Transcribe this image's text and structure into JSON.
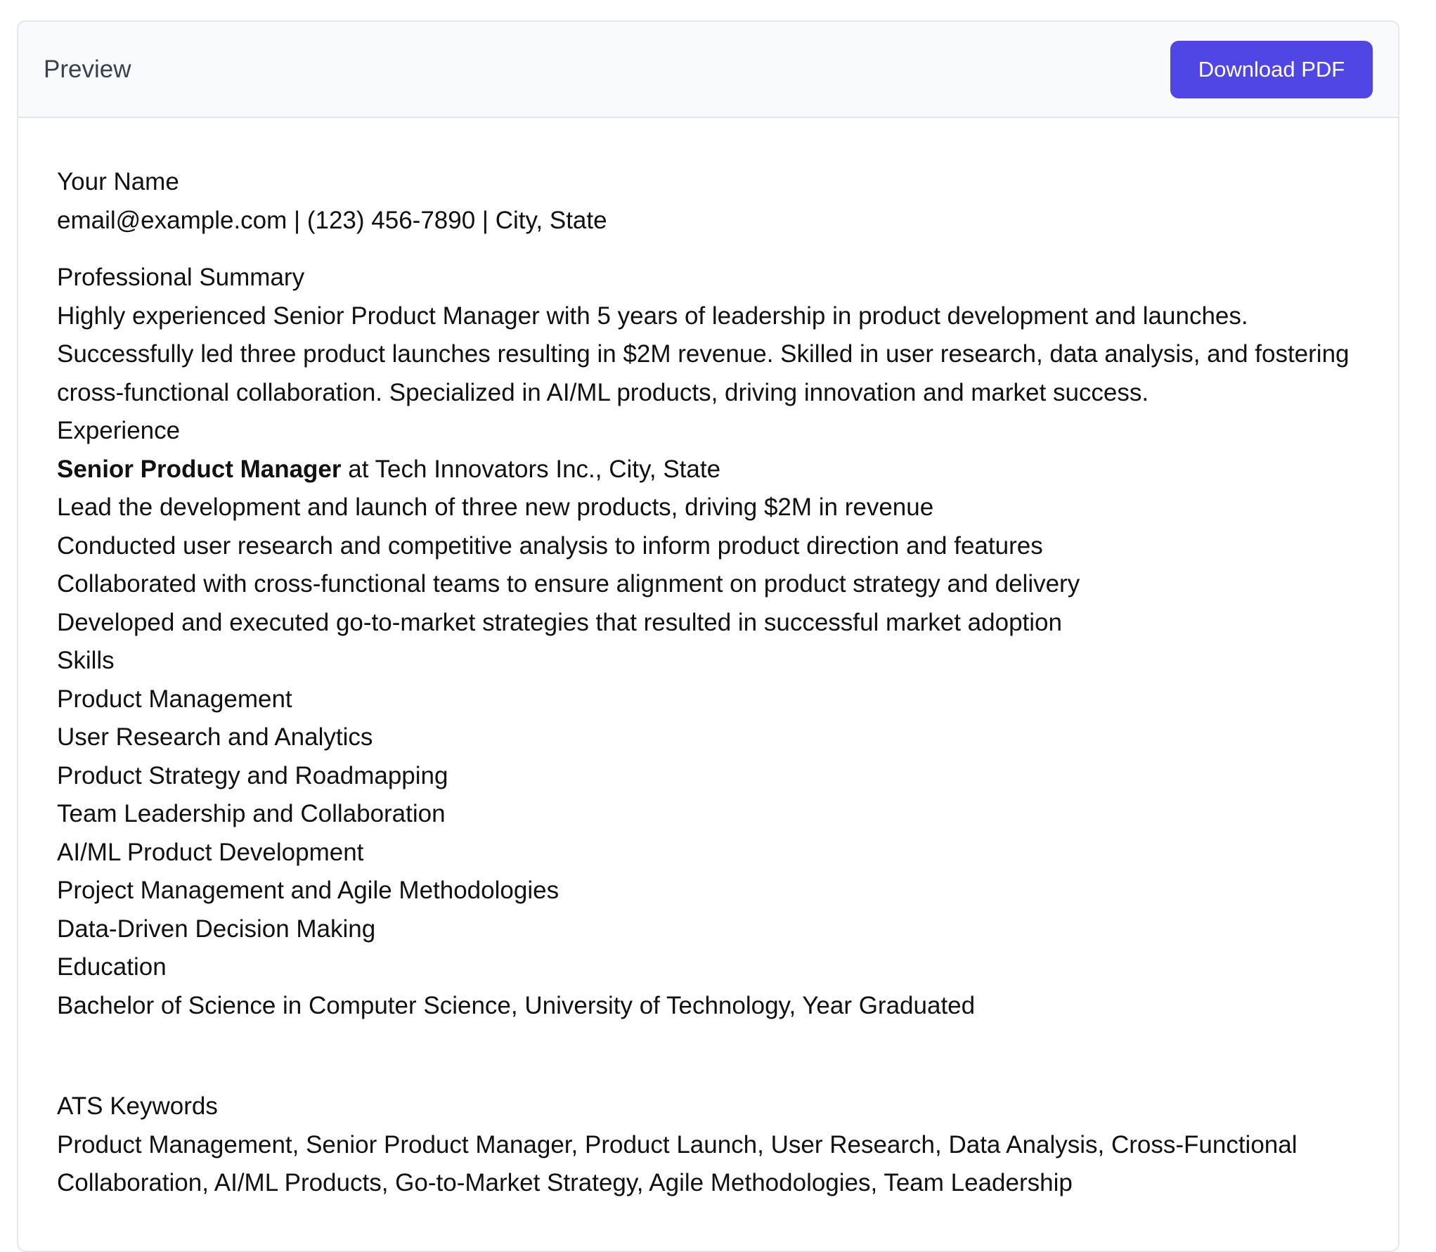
{
  "header": {
    "title": "Preview",
    "download_label": "Download PDF"
  },
  "resume": {
    "name": "Your Name",
    "contact": "email@example.com | (123) 456-7890 | City, State",
    "summary_heading": "Professional Summary",
    "summary_text": "Highly experienced Senior Product Manager with 5 years of leadership in product development and launches. Successfully led three product launches resulting in $2M revenue. Skilled in user research, data analysis, and fostering cross-functional collaboration. Specialized in AI/ML products, driving innovation and market success.",
    "experience_heading": "Experience",
    "job_title": "Senior Product Manager",
    "job_company": " at Tech Innovators Inc., City, State",
    "job_bullets": [
      "Lead the development and launch of three new products, driving $2M in revenue",
      "Conducted user research and competitive analysis to inform product direction and features",
      "Collaborated with cross-functional teams to ensure alignment on product strategy and delivery",
      "Developed and executed go-to-market strategies that resulted in successful market adoption"
    ],
    "skills_heading": "Skills",
    "skills": [
      "Product Management",
      "User Research and Analytics",
      "Product Strategy and Roadmapping",
      "Team Leadership and Collaboration",
      "AI/ML Product Development",
      "Project Management and Agile Methodologies",
      "Data-Driven Decision Making"
    ],
    "education_heading": "Education",
    "education_text": "Bachelor of Science in Computer Science, University of Technology, Year Graduated"
  },
  "ats": {
    "heading": "ATS Keywords",
    "keywords": "Product Management, Senior Product Manager, Product Launch, User Research, Data Analysis, Cross-Functional Collaboration, AI/ML Products, Go-to-Market Strategy, Agile Methodologies, Team Leadership"
  },
  "colors": {
    "accent": "#4f46e5",
    "header_bg": "#f9fafb",
    "border": "#e5e7eb"
  }
}
